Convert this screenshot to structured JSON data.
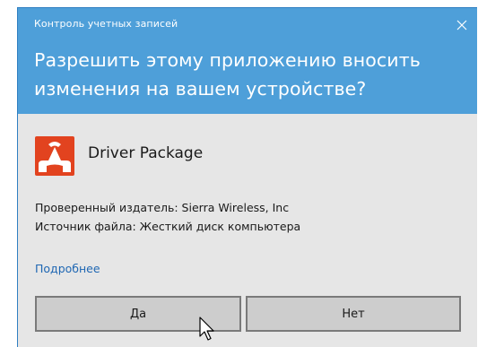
{
  "dialog": {
    "title": "Контроль учетных записей",
    "question": "Разрешить этому приложению вносить изменения на вашем устройстве?",
    "close_icon": "close-icon"
  },
  "app": {
    "name": "Driver Package",
    "icon": "driver-package-app-icon",
    "publisher": "Проверенный издатель: Sierra Wireless, Inc",
    "source": "Источник файла: Жесткий диск компьютера"
  },
  "more_link": "Подробнее",
  "buttons": {
    "yes": "Да",
    "no": "Нет"
  },
  "colors": {
    "header": "#4e9fd9",
    "body": "#e6e6e6",
    "link": "#1f67b3",
    "icon_red": "#e2431f"
  }
}
